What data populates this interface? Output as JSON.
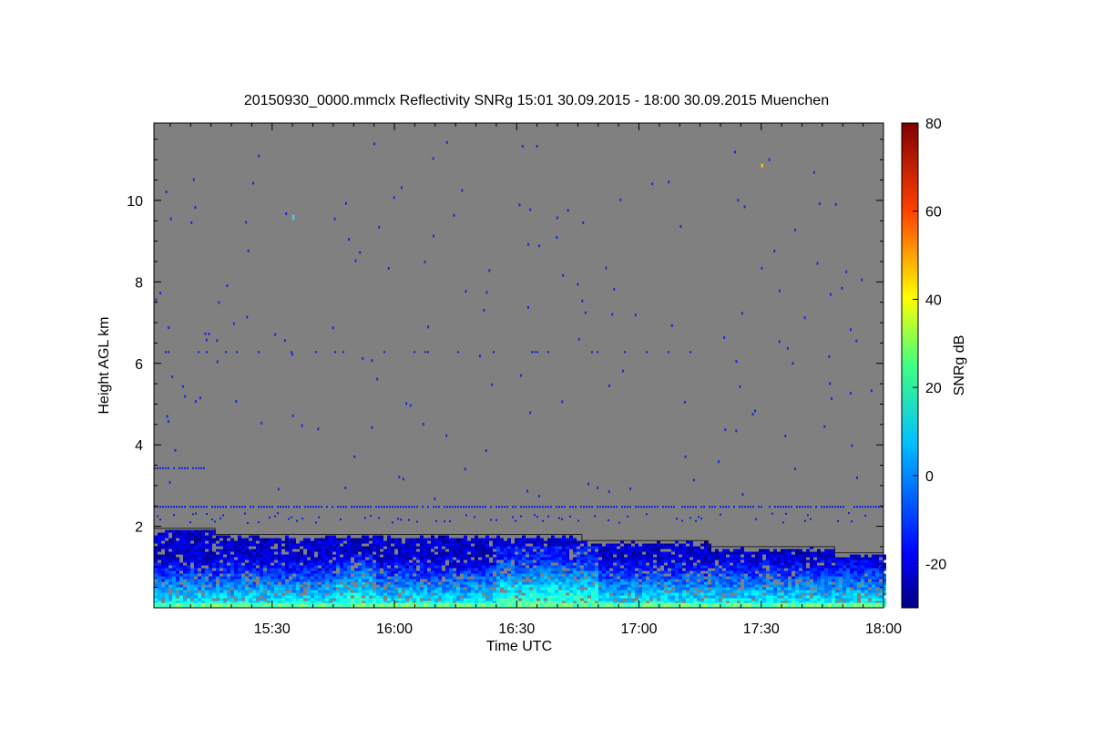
{
  "chart_data": {
    "type": "heatmap",
    "title": "20150930_0000.mmclx Reflectivity SNRg   15:01 30.09.2015 - 18:00 30.09.2015 Muenchen",
    "xlabel": "Time UTC",
    "ylabel": "Height AGL km",
    "colorbar_label": "SNRg dB",
    "x_range_minutes_utc": [
      901,
      1080
    ],
    "y_range_km": [
      0.0,
      11.9
    ],
    "x_ticks": [
      {
        "label": "15:30",
        "minute": 930
      },
      {
        "label": "16:00",
        "minute": 960
      },
      {
        "label": "16:30",
        "minute": 990
      },
      {
        "label": "17:00",
        "minute": 1020
      },
      {
        "label": "17:30",
        "minute": 1050
      },
      {
        "label": "18:00",
        "minute": 1080
      }
    ],
    "y_ticks": [
      {
        "label": "2",
        "value": 2
      },
      {
        "label": "4",
        "value": 4
      },
      {
        "label": "6",
        "value": 6
      },
      {
        "label": "8",
        "value": 8
      },
      {
        "label": "10",
        "value": 10
      }
    ],
    "colorbar_range_db": [
      -30,
      80
    ],
    "colorbar_ticks": [
      {
        "label": "-20",
        "value": -20
      },
      {
        "label": "0",
        "value": 0
      },
      {
        "label": "20",
        "value": 20
      },
      {
        "label": "40",
        "value": 40
      },
      {
        "label": "60",
        "value": 60
      },
      {
        "label": "80",
        "value": 80
      }
    ],
    "colormap": "jet",
    "no_signal_color": "#808080",
    "boundary_layer_line": [
      {
        "minute": 901,
        "height_km": 1.95
      },
      {
        "minute": 916,
        "height_km": 1.95
      },
      {
        "minute": 916,
        "height_km": 1.8
      },
      {
        "minute": 1006,
        "height_km": 1.8
      },
      {
        "minute": 1006,
        "height_km": 1.65
      },
      {
        "minute": 1037,
        "height_km": 1.65
      },
      {
        "minute": 1037,
        "height_km": 1.5
      },
      {
        "minute": 1068,
        "height_km": 1.5
      },
      {
        "minute": 1068,
        "height_km": 1.35
      },
      {
        "minute": 1080,
        "height_km": 1.35
      }
    ]
  }
}
